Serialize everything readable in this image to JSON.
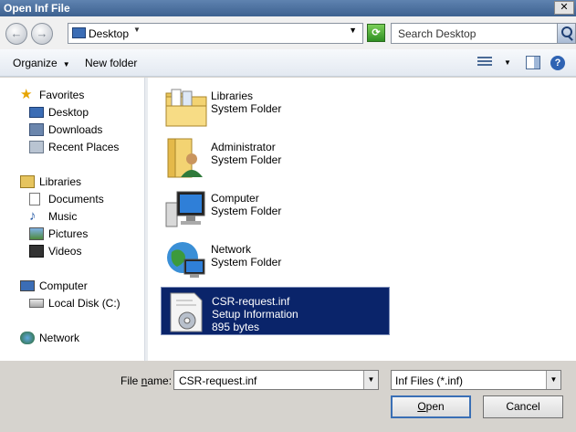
{
  "window": {
    "title": "Open Inf File",
    "close_glyph": "✕"
  },
  "nav": {
    "back_glyph": "←",
    "forward_glyph": "→",
    "address": "Desktop",
    "search_placeholder": "Search Desktop"
  },
  "toolbar": {
    "organize": "Organize",
    "new_folder": "New folder",
    "help_glyph": "?"
  },
  "sidebar": {
    "favorites": {
      "label": "Favorites",
      "items": [
        "Desktop",
        "Downloads",
        "Recent Places"
      ]
    },
    "libraries": {
      "label": "Libraries",
      "items": [
        "Documents",
        "Music",
        "Pictures",
        "Videos"
      ]
    },
    "computer": {
      "label": "Computer",
      "items": [
        "Local Disk (C:)"
      ]
    },
    "network": {
      "label": "Network"
    }
  },
  "files": [
    {
      "name": "Libraries",
      "type": "System Folder",
      "icon": "libraries-folder-icon"
    },
    {
      "name": "Administrator",
      "type": "System Folder",
      "icon": "user-folder-icon"
    },
    {
      "name": "Computer",
      "type": "System Folder",
      "icon": "computer-icon"
    },
    {
      "name": "Network",
      "type": "System Folder",
      "icon": "network-icon"
    },
    {
      "name": "CSR-request.inf",
      "type": "Setup Information",
      "size": "895 bytes",
      "icon": "inf-file-icon",
      "selected": true
    }
  ],
  "bottom": {
    "file_name_label_pre": "File ",
    "file_name_label_u": "n",
    "file_name_label_post": "ame:",
    "file_name_value": "CSR-request.inf",
    "file_type": "Inf Files (*.inf)",
    "open_u": "O",
    "open_rest": "pen",
    "cancel": "Cancel"
  },
  "colors": {
    "selection": "#0a246a",
    "titlebar": "#4a6f9f",
    "accent": "#3a6fb5"
  }
}
